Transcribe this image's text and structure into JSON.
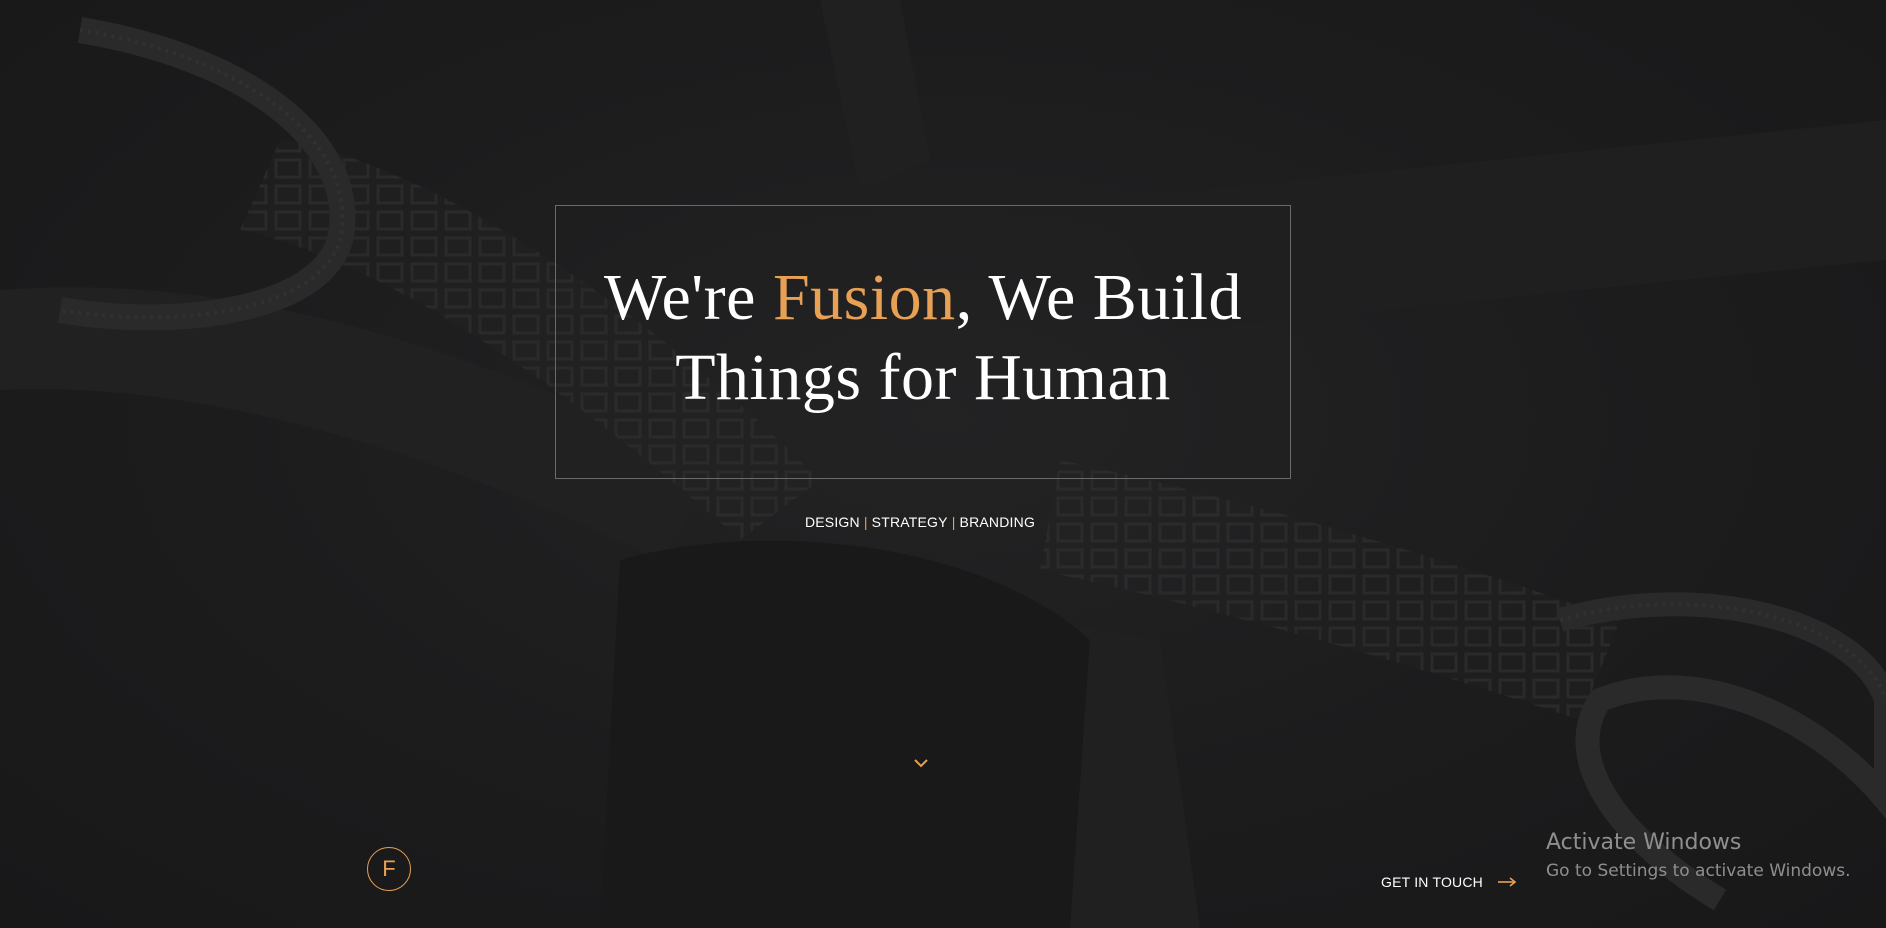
{
  "hero": {
    "headline_part1": "We're ",
    "headline_accent": "Fusion",
    "headline_part2": ", We Build",
    "headline_line2": "Things for Human"
  },
  "services": {
    "items": [
      "DESIGN",
      "STRATEGY",
      "BRANDING"
    ],
    "separator": "|"
  },
  "logo": {
    "letter": "F"
  },
  "cta": {
    "label": "GET IN TOUCH",
    "icon": "arrow-right-icon"
  },
  "scroll": {
    "icon": "chevron-down-icon"
  },
  "watermark": {
    "title": "Activate Windows",
    "subtitle": "Go to Settings to activate Windows."
  },
  "colors": {
    "background": "#1b1b1c",
    "accent": "#e8a054",
    "text": "#ffffff",
    "border": "#6a6a6a",
    "watermark": "#8f8f8f"
  }
}
